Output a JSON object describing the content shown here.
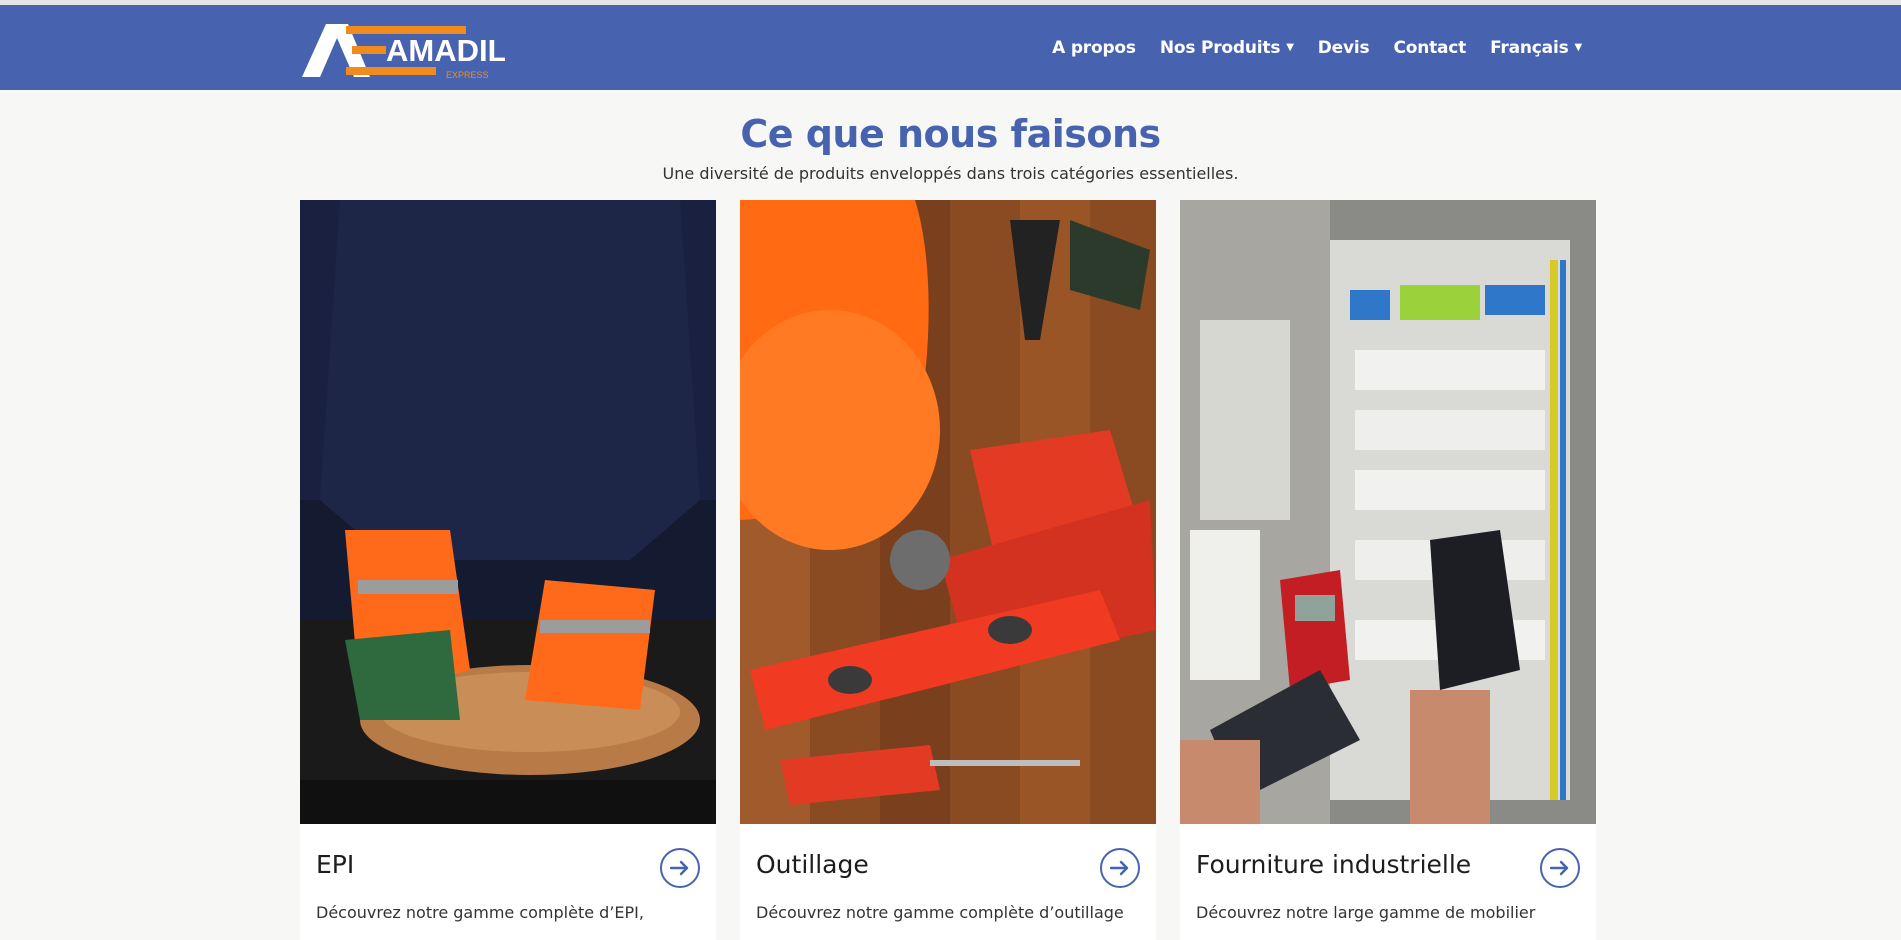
{
  "brand": {
    "logo_letter": "A",
    "name": "AMADIL",
    "tagline": "EXPRESS"
  },
  "nav": {
    "about": "A propos",
    "products": "Nos Produits",
    "quote": "Devis",
    "contact": "Contact",
    "language": "Français"
  },
  "section": {
    "title": "Ce que nous faisons",
    "subtitle": "Une diversité de produits enveloppés dans trois catégories essentielles."
  },
  "cards": [
    {
      "title": "EPI",
      "desc": "Découvrez notre gamme complète d’EPI,"
    },
    {
      "title": "Outillage",
      "desc": "Découvrez notre gamme complète d’outillage"
    },
    {
      "title": "Fourniture industrielle",
      "desc": "Découvrez notre large gamme de mobilier"
    }
  ],
  "colors": {
    "brand_blue": "#4763b0",
    "brand_orange": "#f08c1e"
  },
  "icons": {
    "card_arrow": "arrow-right-circle-icon",
    "dropdown": "caret-down-icon"
  }
}
